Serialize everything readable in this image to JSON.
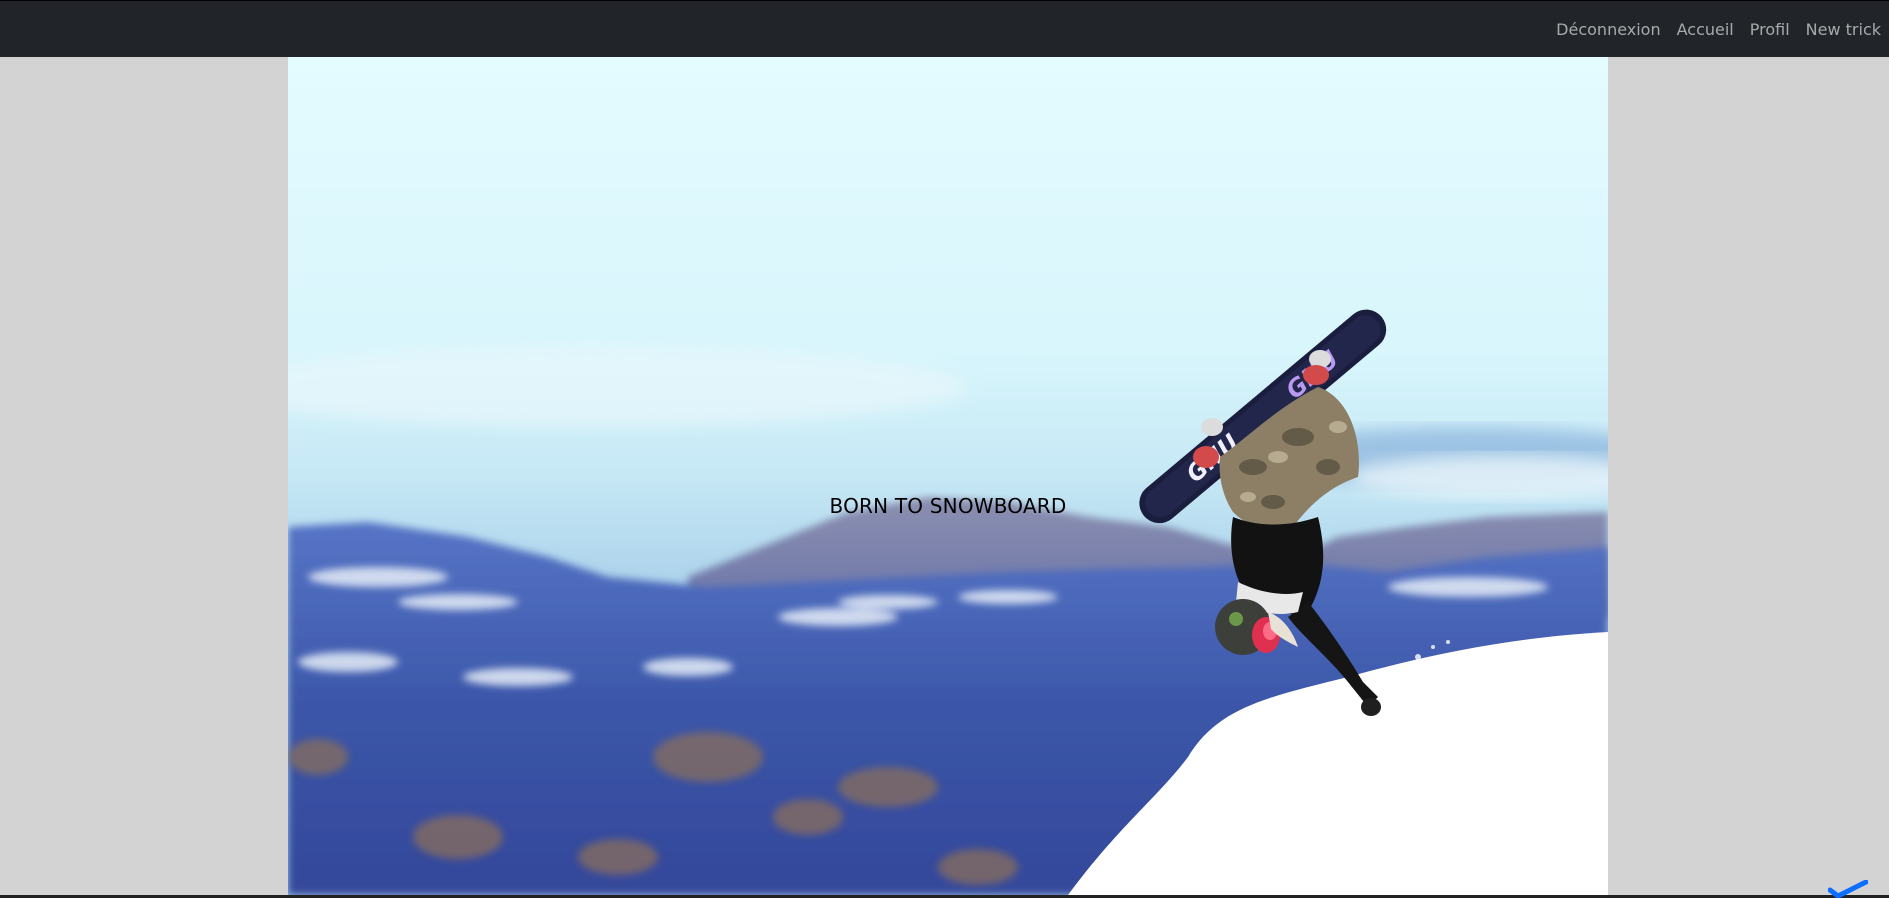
{
  "nav": {
    "items": [
      {
        "label": "Déconnexion"
      },
      {
        "label": "Accueil"
      },
      {
        "label": "Profil"
      },
      {
        "label": "New trick"
      }
    ]
  },
  "hero": {
    "title": "BORN TO SNOWBOARD",
    "image_icon": "snowboarder-photo",
    "board_text": "GNU GNU"
  },
  "colors": {
    "navbar": "#212529",
    "page_background": "#d3d3d3",
    "nav_link": "#9a9da0",
    "accent": "#0d6efd"
  }
}
